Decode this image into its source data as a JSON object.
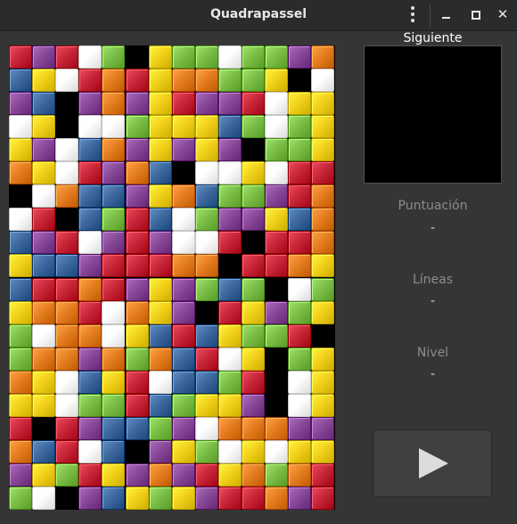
{
  "window": {
    "title": "Quadrapassel"
  },
  "panel": {
    "next_label": "Siguiente",
    "score_label": "Puntuación",
    "score_value": "-",
    "lines_label": "Líneas",
    "lines_value": "-",
    "level_label": "Nivel",
    "level_value": "-"
  },
  "icons": {
    "menu": "menu-icon",
    "minimize": "minimize-icon",
    "maximize": "maximize-icon",
    "close": "close-icon",
    "play": "play-icon"
  },
  "colors": {
    "R": "#c8283a",
    "P": "#8a4a9a",
    "W": "#ffffff",
    "G": "#7cc04a",
    "Y": "#f2d21c",
    "O": "#e57f22",
    "B": "#3e6aa0",
    "K": "#000000"
  },
  "board": {
    "columns": 14,
    "rows": 20,
    "cells": [
      "RPRWGKYGGWGGPO",
      "BYWRORYOOGGYKW",
      "PBKPOPYRPPRWYY",
      "WYKWWGYYYBGWGY",
      "YPWBOPYPYPKGGY",
      "OYWRPOBKWWYWRR",
      "KWOBBPYOBGGPRO",
      "WRKBGRBWGPPYBO",
      "BPRWPRPWWRKRRO",
      "YBBPRRROOKRROY",
      "BRRORPYPGBGKWG",
      "YOORWOYPKRYPGY",
      "GWOOWYBRBYGGRK",
      "GOOPOGOBRWYKGY",
      "OYWBYRWBBGRKWY",
      "YYWGGRBGYYPKWY",
      "RKRPBBGPWOOOPP",
      "OBRWBKPYGWYWYY",
      "PYGRYPOPRYOGOR",
      "GWKPBYGYPRROPR"
    ]
  }
}
